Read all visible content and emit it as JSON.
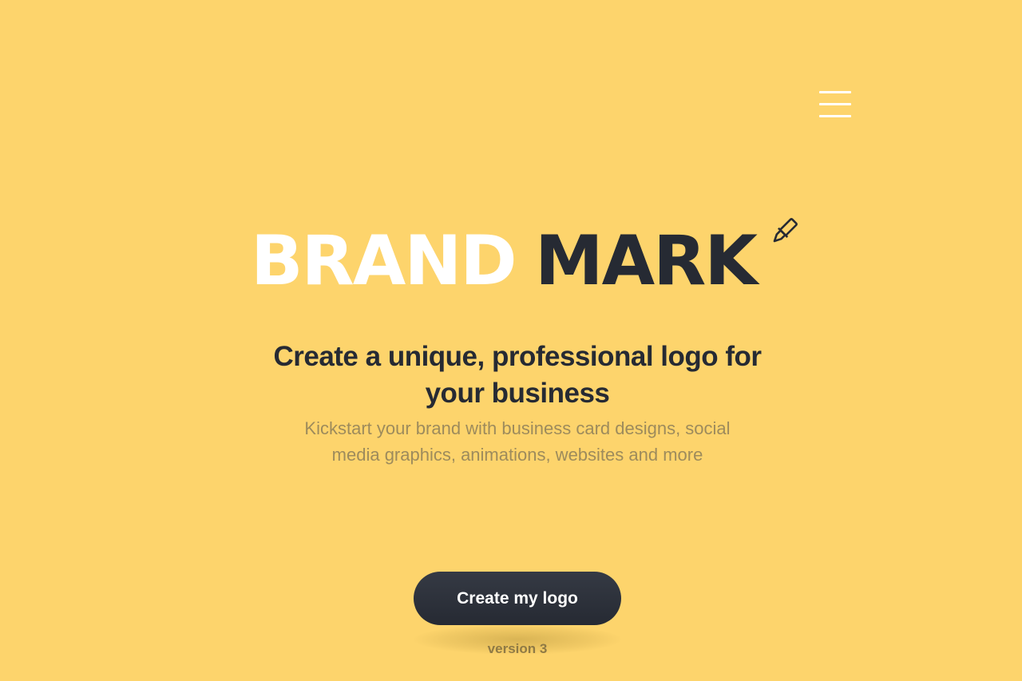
{
  "header": {
    "menu_icon": "hamburger-menu-icon"
  },
  "logo": {
    "brand_text": "BRAND",
    "mark_text": "MARK",
    "pen_icon": "pen-nib-icon",
    "brand_color": "#FFFFFF",
    "mark_color": "#262A33"
  },
  "hero": {
    "headline": "Create a unique, professional logo for your business",
    "subtext": "Kickstart your brand with business card designs, social media graphics, animations, websites and more",
    "cta_label": "Create my logo",
    "version": "version 3"
  },
  "colors": {
    "background": "#FDD46C",
    "button": "#262A33",
    "subtext": "#9D8B5C"
  }
}
